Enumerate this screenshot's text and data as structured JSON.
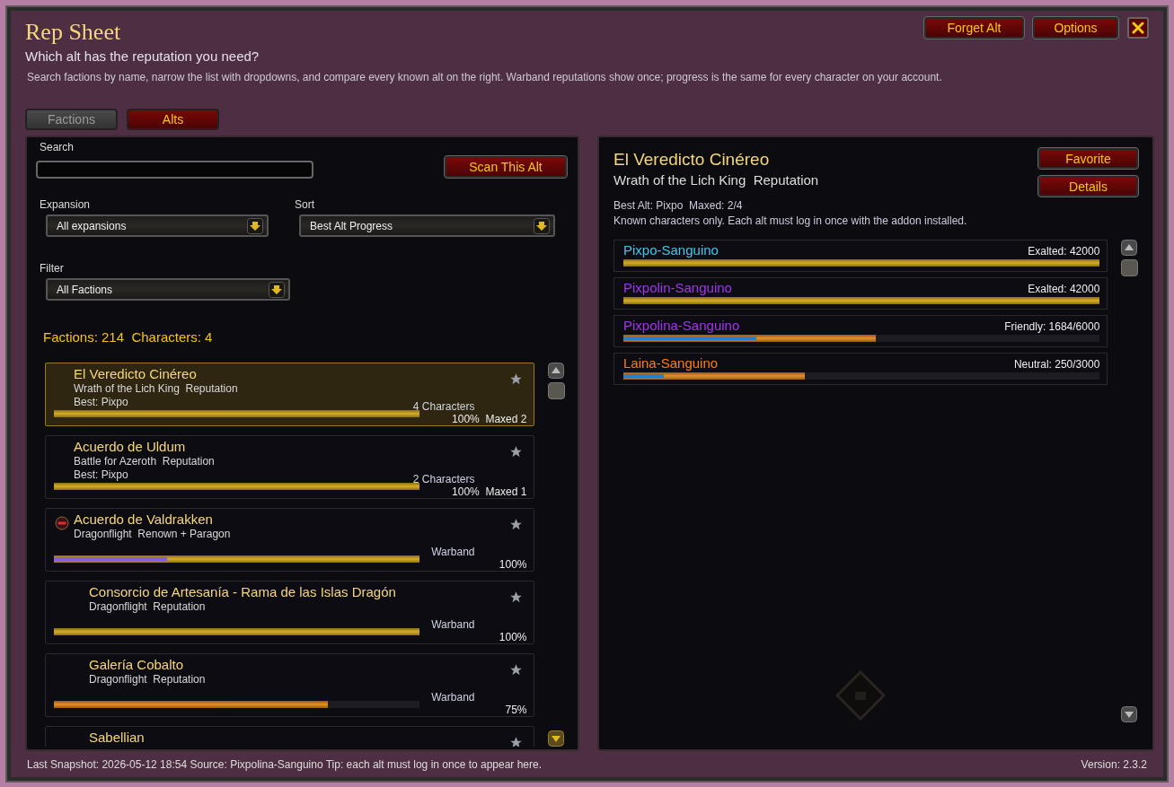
{
  "window": {
    "title": "Rep Sheet",
    "subtitle": "Which alt has the reputation you need?",
    "description": "Search factions by name, narrow the list with dropdowns, and compare every known alt on the right. Warband reputations show once; progress is the same for every character on your account."
  },
  "header_buttons": [
    "Forget Alt",
    "Options"
  ],
  "tabs": [
    {
      "label": "Factions",
      "selected": true
    },
    {
      "label": "Alts",
      "selected": false
    }
  ],
  "left_panel": {
    "search": {
      "label": "Search"
    },
    "scan_button": "Scan This Alt",
    "dropdowns": [
      {
        "label": "Expansion",
        "value": "All expansions"
      },
      {
        "label": "Sort",
        "value": "Best Alt Progress"
      },
      {
        "label": "Filter",
        "value": "All Factions"
      }
    ],
    "summary": "Factions: 214  Characters: 4",
    "factions": [
      {
        "name": "El Veredicto Cinéreo",
        "subtitle": "Wrath of the Lich King  Reputation",
        "best": "Best: Pixpo",
        "count": "4 Characters",
        "progress": "100%  Maxed 2",
        "bar": {
          "level": 1
        },
        "selected": true,
        "badge": false,
        "indented": false
      },
      {
        "name": "Acuerdo de Uldum",
        "subtitle": "Battle for Azeroth  Reputation",
        "best": "Best: Pixpo",
        "count": "2 Characters",
        "progress": "100%  Maxed 1",
        "bar": {
          "level": 1
        },
        "selected": false,
        "badge": false,
        "indented": false
      },
      {
        "name": "Acuerdo de Valdrakken",
        "subtitle": "Dragonflight  Renown + Paragon",
        "count": "Warband",
        "progress": "100%",
        "bar": {
          "level": 1
        },
        "sub_bar": {
          "level": 0.31
        },
        "selected": false,
        "badge": true,
        "indented": false
      },
      {
        "name": "Consorcio de Artesanía - Rama de las Islas Dragón",
        "subtitle": "Dragonflight  Reputation",
        "count": "Warband",
        "progress": "100%",
        "bar": {
          "level": 1
        },
        "selected": false,
        "badge": false,
        "indented": true
      },
      {
        "name": "Galería Cobalto",
        "subtitle": "Dragonflight  Reputation",
        "count": "Warband",
        "progress": "75%",
        "bar": {
          "level": 0.75
        },
        "selected": false,
        "badge": false,
        "indented": true
      },
      {
        "name": "Sabellian",
        "selected": false,
        "badge": false,
        "indented": true
      }
    ]
  },
  "right_panel": {
    "title": "El Veredicto Cinéreo",
    "subtitle": "Wrath of the Lich King  Reputation",
    "buttons": [
      "Favorite",
      "Details"
    ],
    "best_line": "Best Alt: Pixpo  Maxed: 2/4",
    "note": "Known characters only. Each alt must log in once with the addon installed.",
    "alts": [
      {
        "name": "Pixpo-Sanguino",
        "color": "#3fc7eb",
        "standing": "Exalted: 42000",
        "bar": {
          "level": 1
        }
      },
      {
        "name": "Pixpolin-Sanguino",
        "color": "#a335ee",
        "standing": "Exalted: 42000",
        "bar": {
          "level": 1
        }
      },
      {
        "name": "Pixpolina-Sanguino",
        "color": "#a335ee",
        "standing": "Friendly: 1684/6000",
        "bar": {
          "level": 0.53
        },
        "sub_bar": {
          "level": 0.28
        }
      },
      {
        "name": "Laina-Sanguino",
        "color": "#ff7c0a",
        "standing": "Neutral: 250/3000",
        "bar": {
          "level": 0.38
        },
        "sub_bar": {
          "level": 0.085
        }
      }
    ]
  },
  "status_bar": {
    "left": "Last Snapshot: 2026-05-12 18:54  Source: Pixpolina-Sanguino  Tip: each alt must log in once to appear here.",
    "right": "Version: 2.3.2"
  }
}
